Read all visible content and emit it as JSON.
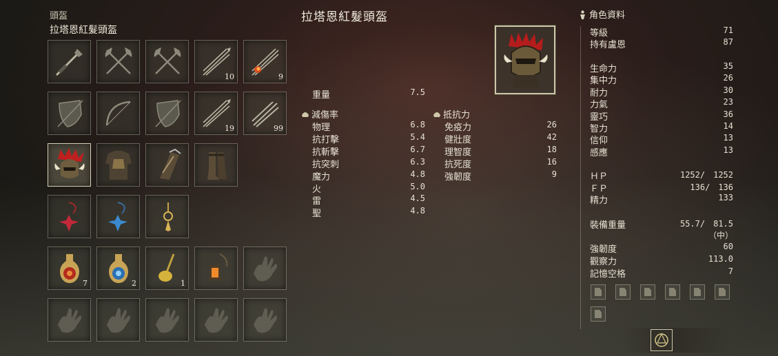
{
  "left_panel": {
    "slot_type": "頭盔",
    "item_name": "拉塔恩紅髮頭盔",
    "grid": [
      {
        "icon": "sword-axe-icon",
        "count": ""
      },
      {
        "icon": "crossed-axes-icon",
        "count": ""
      },
      {
        "icon": "crossed-axes-icon",
        "count": ""
      },
      {
        "icon": "arrows-icon",
        "count": "10"
      },
      {
        "icon": "fire-arrows-icon",
        "count": "9"
      },
      {
        "icon": "shield-icon",
        "count": ""
      },
      {
        "icon": "bow-icon",
        "count": ""
      },
      {
        "icon": "shield-icon",
        "count": ""
      },
      {
        "icon": "arrows-icon",
        "count": "19"
      },
      {
        "icon": "bolts-icon",
        "count": "99"
      },
      {
        "icon": "red-haired-helm-icon",
        "count": "",
        "selected": true
      },
      {
        "icon": "chest-armor-icon",
        "count": ""
      },
      {
        "icon": "gauntlets-icon",
        "count": ""
      },
      {
        "icon": "greaves-icon",
        "count": ""
      },
      {
        "icon": "empty",
        "count": ""
      },
      {
        "icon": "red-talisman-icon",
        "count": ""
      },
      {
        "icon": "blue-talisman-icon",
        "count": ""
      },
      {
        "icon": "gold-pendant-icon",
        "count": ""
      },
      {
        "icon": "empty",
        "count": ""
      },
      {
        "icon": "empty",
        "count": ""
      },
      {
        "icon": "crimson-flask-icon",
        "count": "7"
      },
      {
        "icon": "cerulean-flask-icon",
        "count": "2"
      },
      {
        "icon": "golden-seed-icon",
        "count": "1"
      },
      {
        "icon": "lantern-icon",
        "count": ""
      },
      {
        "icon": "empty-hand-icon",
        "count": ""
      },
      {
        "icon": "empty-hand-icon",
        "count": ""
      },
      {
        "icon": "empty-hand-icon",
        "count": ""
      },
      {
        "icon": "empty-hand-icon",
        "count": ""
      },
      {
        "icon": "empty-hand-icon",
        "count": ""
      },
      {
        "icon": "empty-hand-icon",
        "count": ""
      }
    ]
  },
  "item": {
    "title": "拉塔恩紅髮頭盔",
    "weight_label": "重量",
    "weight": "7.5",
    "negation_header": "減傷率",
    "negation": [
      {
        "label": "物理",
        "value": "6.8"
      },
      {
        "label": "抗打擊",
        "value": "5.4"
      },
      {
        "label": "抗斬擊",
        "value": "6.7"
      },
      {
        "label": "抗突刺",
        "value": "6.3"
      },
      {
        "label": "魔力",
        "value": "4.8"
      },
      {
        "label": "火",
        "value": "5.0"
      },
      {
        "label": "雷",
        "value": "4.5"
      },
      {
        "label": "聖",
        "value": "4.8"
      }
    ],
    "resistance_header": "抵抗力",
    "resistance": [
      {
        "label": "免疫力",
        "value": "26"
      },
      {
        "label": "健壯度",
        "value": "42"
      },
      {
        "label": "理智度",
        "value": "18"
      },
      {
        "label": "抗死度",
        "value": "16"
      },
      {
        "label": "強韌度",
        "value": "9"
      }
    ]
  },
  "character": {
    "header": "角色資料",
    "level": {
      "label": "等級",
      "value": "71"
    },
    "runes": {
      "label": "持有盧恩",
      "value": "87"
    },
    "attributes": [
      {
        "label": "生命力",
        "value": "35"
      },
      {
        "label": "集中力",
        "value": "26"
      },
      {
        "label": "耐力",
        "value": "30"
      },
      {
        "label": "力氣",
        "value": "23"
      },
      {
        "label": "靈巧",
        "value": "36"
      },
      {
        "label": "智力",
        "value": "14"
      },
      {
        "label": "信仰",
        "value": "13"
      },
      {
        "label": "感應",
        "value": "13"
      }
    ],
    "hp": {
      "label": "ＨＰ",
      "value": "1252/　1252"
    },
    "fp": {
      "label": "ＦＰ",
      "value": "136/　136"
    },
    "stamina": {
      "label": "精力",
      "value": "133"
    },
    "equip_load": {
      "label": "裝備重量",
      "value": "55.7/　81.5",
      "state": "（中）"
    },
    "poise": {
      "label": "強韌度",
      "value": "60"
    },
    "discovery": {
      "label": "觀察力",
      "value": "113.0"
    },
    "memory_slots": {
      "label": "記憶空格",
      "value": "7"
    }
  }
}
